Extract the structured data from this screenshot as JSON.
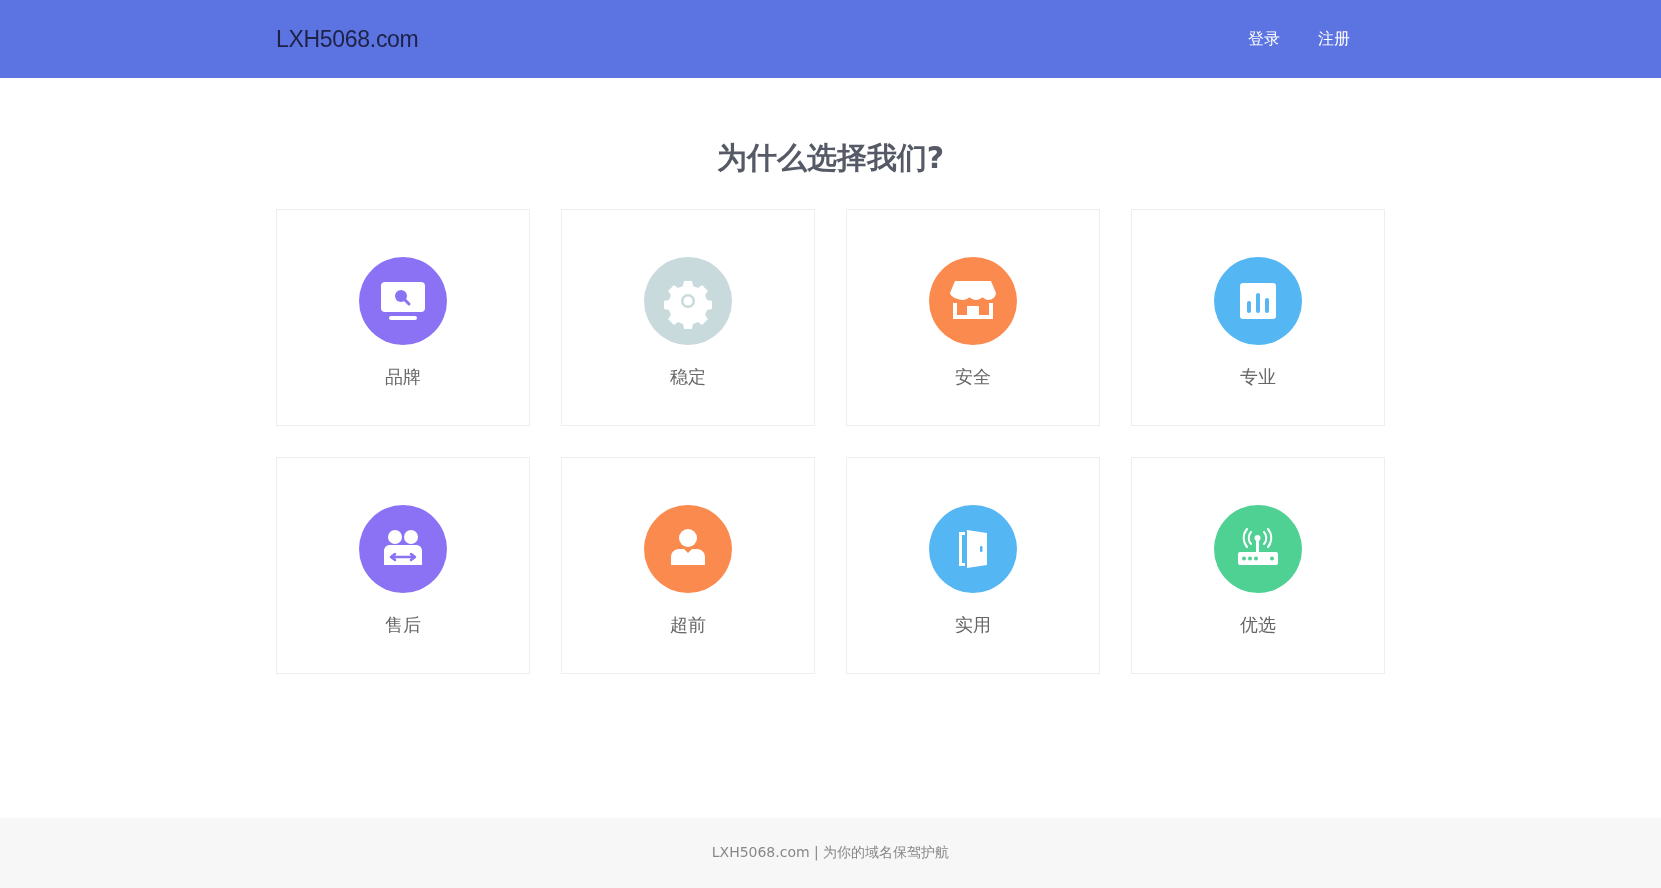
{
  "header": {
    "logo": "LXH5068.com",
    "links": [
      "登录",
      "注册"
    ]
  },
  "title": "为什么选择我们?",
  "features": [
    {
      "label": "品牌",
      "color": "#8b72f4"
    },
    {
      "label": "稳定",
      "color": "#c8dadc"
    },
    {
      "label": "安全",
      "color": "#fb8a4f"
    },
    {
      "label": "专业",
      "color": "#54b6f2"
    },
    {
      "label": "售后",
      "color": "#8b72f4"
    },
    {
      "label": "超前",
      "color": "#fb8a4f"
    },
    {
      "label": "实用",
      "color": "#54b6f2"
    },
    {
      "label": "优选",
      "color": "#4ed193"
    }
  ],
  "footer": "LXH5068.com | 为你的域名保驾护航"
}
